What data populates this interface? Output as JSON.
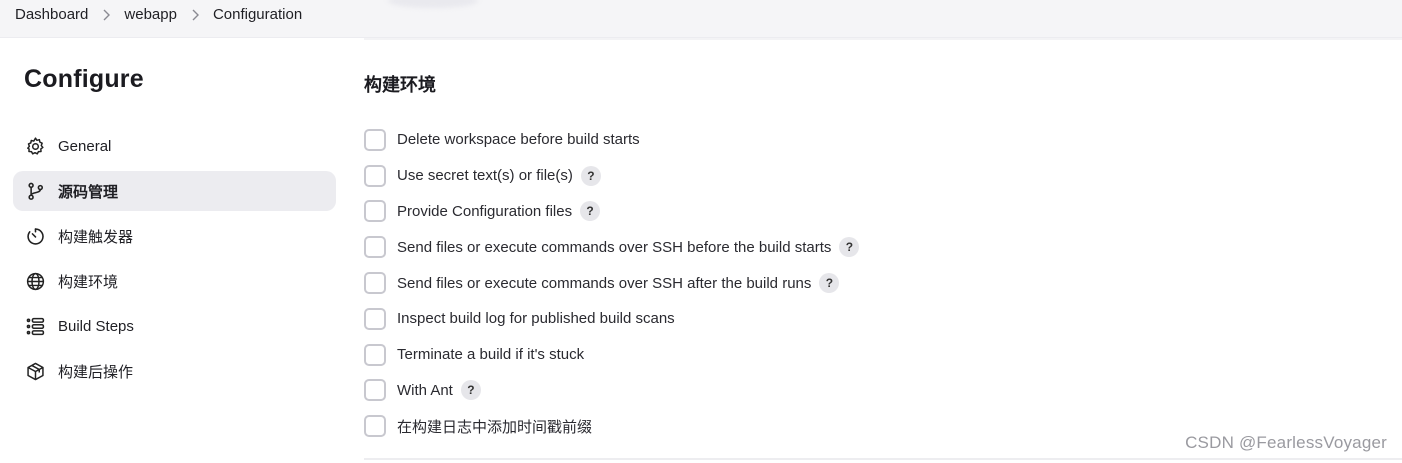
{
  "breadcrumb": [
    {
      "label": "Dashboard"
    },
    {
      "label": "webapp"
    },
    {
      "label": "Configuration"
    }
  ],
  "page": {
    "title": "Configure"
  },
  "sidebar": {
    "items": [
      {
        "label": "General",
        "icon": "gear-icon",
        "active": false
      },
      {
        "label": "源码管理",
        "icon": "git-branch-icon",
        "active": true
      },
      {
        "label": "构建触发器",
        "icon": "timer-icon",
        "active": false
      },
      {
        "label": "构建环境",
        "icon": "globe-icon",
        "active": false
      },
      {
        "label": "Build Steps",
        "icon": "list-icon",
        "active": false
      },
      {
        "label": "构建后操作",
        "icon": "package-icon",
        "active": false
      }
    ]
  },
  "section": {
    "title": "构建环境",
    "options": [
      {
        "label": "Delete workspace before build starts",
        "checked": false,
        "help": false
      },
      {
        "label": "Use secret text(s) or file(s)",
        "checked": false,
        "help": true
      },
      {
        "label": "Provide Configuration files",
        "checked": false,
        "help": true
      },
      {
        "label": "Send files or execute commands over SSH before the build starts",
        "checked": false,
        "help": true
      },
      {
        "label": "Send files or execute commands over SSH after the build runs",
        "checked": false,
        "help": true
      },
      {
        "label": "Inspect build log for published build scans",
        "checked": false,
        "help": false
      },
      {
        "label": "Terminate a build if it's stuck",
        "checked": false,
        "help": false
      },
      {
        "label": "With Ant",
        "checked": false,
        "help": true
      },
      {
        "label": "在构建日志中添加时间戳前缀",
        "checked": false,
        "help": false
      }
    ],
    "help_glyph": "?"
  },
  "watermark": "CSDN @FearlessVoyager"
}
